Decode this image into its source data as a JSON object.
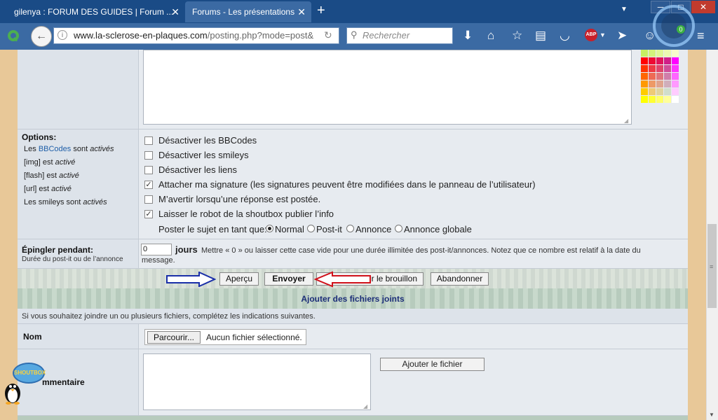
{
  "browser": {
    "tabs": [
      {
        "title": "gilenya : FORUM DES GUIDES | Forum ...",
        "active": false
      },
      {
        "title": "Forums - Les présentations",
        "active": true
      }
    ],
    "new_tab": "+",
    "tab_close": "✕",
    "url_domain": "www.la-sclerose-en-plaques.com",
    "url_path": "/posting.php?mode=post&",
    "search_placeholder": "Rechercher",
    "abp_label": "ABP",
    "notification_count": "0",
    "colors": {
      "titlebar": "#1a4b86",
      "toolbar": "#3b6aa3",
      "page_bg": "#e8c898"
    }
  },
  "palette": {
    "rows": [
      [
        "#c6ef62",
        "#d3f27c",
        "#dff697",
        "#ebf9b1",
        "#f7fccc"
      ],
      [
        "#ff0000",
        "#ee0a33",
        "#e0145a",
        "#d01e88",
        "#ff00ff"
      ],
      [
        "#ff3300",
        "#ee3a44",
        "#e0446b",
        "#d04e99",
        "#ff33ff"
      ],
      [
        "#ff6600",
        "#ee6a55",
        "#e0747c",
        "#d07eaa",
        "#ff66ff"
      ],
      [
        "#ff9900",
        "#ee9a66",
        "#e0a48d",
        "#d0aebb",
        "#ff99ff"
      ],
      [
        "#ffcc00",
        "#eeca77",
        "#e0d49e",
        "#d0decc",
        "#ffccff"
      ],
      [
        "#ffff00",
        "#ffff33",
        "#ffff66",
        "#ffff99",
        "#ffffff"
      ]
    ]
  },
  "options": {
    "title": "Options:",
    "bbcodes_prefix": "Les",
    "bbcodes_link": "BBCodes",
    "bbcodes_mid": "sont",
    "bbcodes_state": "activés",
    "img_prefix": "[img] est",
    "img_state": "activé",
    "flash_prefix": "[flash] est",
    "flash_state": "activé",
    "url_prefix": "[url] est",
    "url_state": "activé",
    "smileys_prefix": "Les smileys sont",
    "smileys_state": "activés",
    "checkboxes": [
      {
        "label": "Désactiver les BBCodes",
        "checked": false
      },
      {
        "label": "Désactiver les smileys",
        "checked": false
      },
      {
        "label": "Désactiver les liens",
        "checked": false
      },
      {
        "label": "Attacher ma signature (les signatures peuvent être modifiées dans le panneau de l’utilisateur)",
        "checked": true
      },
      {
        "label": "M’avertir lorsqu’une réponse est postée.",
        "checked": false
      },
      {
        "label": "Laisser le robot de la shoutbox publier l’info",
        "checked": true
      }
    ],
    "post_as_label": "Poster le sujet en tant que:",
    "post_as_options": [
      {
        "label": "Normal",
        "selected": true
      },
      {
        "label": "Post-it",
        "selected": false
      },
      {
        "label": "Annonce",
        "selected": false
      },
      {
        "label": "Annonce globale",
        "selected": false
      }
    ]
  },
  "pin": {
    "title": "Épingler pendant:",
    "subtitle": "Durée du post-it ou de l’annonce",
    "value": "0",
    "unit": "jours",
    "note": "Mettre « 0 » ou laisser cette case vide pour une durée illimitée des post-it/annonces. Notez que ce nombre est relatif à la date du message."
  },
  "actions": {
    "preview": "Aperçu",
    "send": "Envoyer",
    "draft": "r le brouillon",
    "cancel": "Abandonner"
  },
  "attachments": {
    "title": "Ajouter des fichiers joints",
    "note": "Si vous souhaitez joindre un ou plusieurs fichiers, complétez les indications suivantes.",
    "name_label": "Nom",
    "browse": "Parcourir...",
    "no_file": "Aucun fichier sélectionné.",
    "comment_label": "mmentaire",
    "add_file": "Ajouter le fichier"
  },
  "shoutbox": {
    "label": "SHOUTBOX"
  }
}
